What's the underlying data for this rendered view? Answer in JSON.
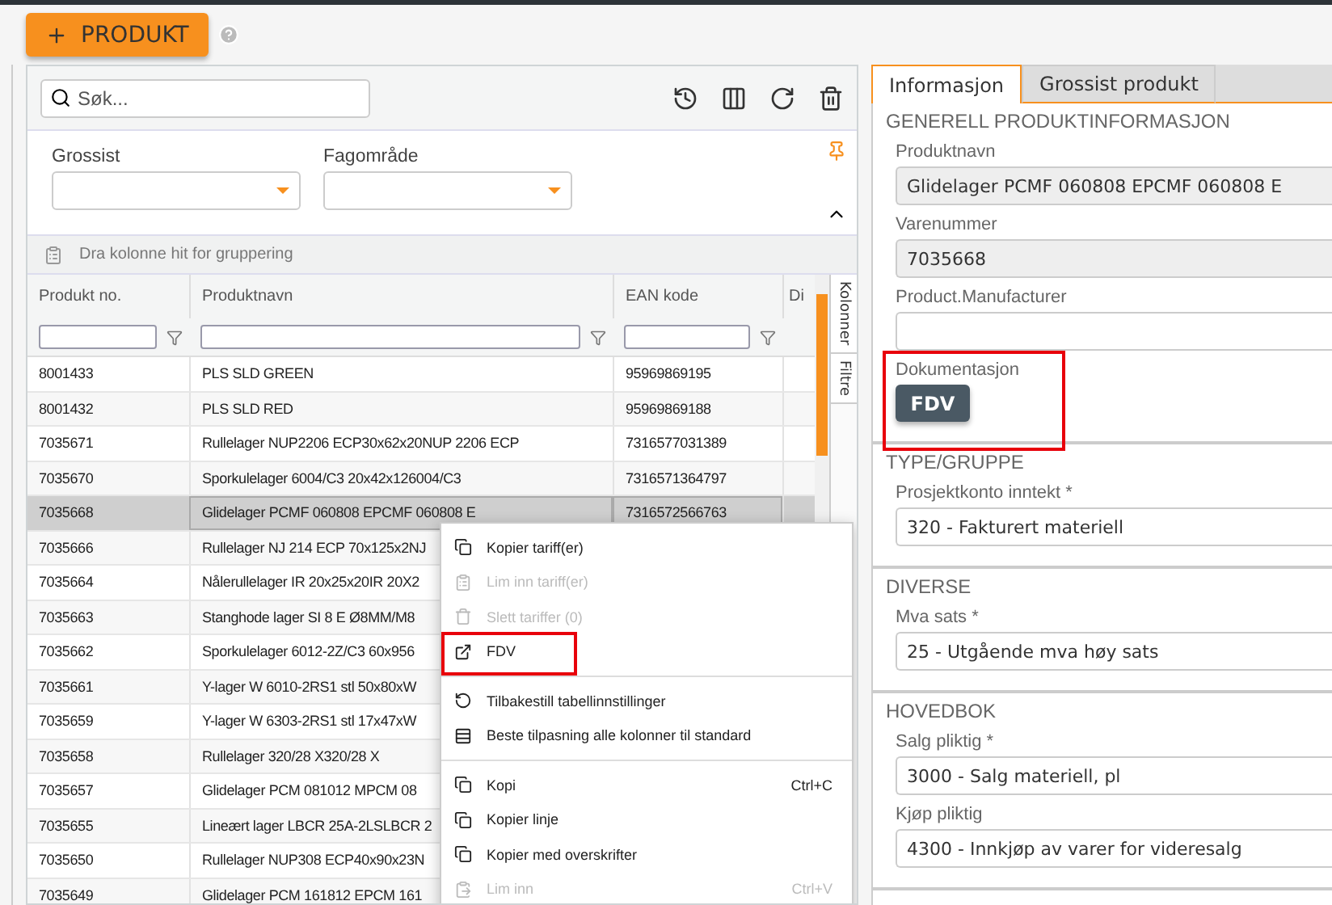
{
  "toolbar": {
    "add_button": "PRODUKT"
  },
  "grid": {
    "search": {
      "placeholder": "Søk..."
    },
    "filters": [
      {
        "label": "Grossist"
      },
      {
        "label": "Fagområde"
      }
    ],
    "group_hint": "Dra kolonne hit for gruppering",
    "columns": [
      "Produkt no.",
      "Produktnavn",
      "EAN kode",
      "Di"
    ],
    "side_tabs": [
      "Kolonner",
      "Filtre"
    ],
    "rows": [
      {
        "no": "8001433",
        "name": "PLS SLD GREEN",
        "ean": "95969869195",
        "selected": false
      },
      {
        "no": "8001432",
        "name": "PLS SLD RED",
        "ean": "95969869188",
        "selected": false
      },
      {
        "no": "7035671",
        "name": "Rullelager NUP2206 ECP30x62x20NUP 2206 ECP",
        "ean": "7316577031389",
        "selected": false
      },
      {
        "no": "7035670",
        "name": "Sporkulelager 6004/C3 20x42x126004/C3",
        "ean": "7316571364797",
        "selected": false
      },
      {
        "no": "7035668",
        "name": "Glidelager PCMF 060808 EPCMF 060808 E",
        "ean": "7316572566763",
        "selected": true
      },
      {
        "no": "7035666",
        "name": "Rullelager NJ 214 ECP 70x125x2NJ",
        "ean": "",
        "selected": false
      },
      {
        "no": "7035664",
        "name": "Nålerullelager IR 20x25x20IR 20X2",
        "ean": "",
        "selected": false
      },
      {
        "no": "7035663",
        "name": "Stanghode lager SI 8 E Ø8MM/M8",
        "ean": "",
        "selected": false
      },
      {
        "no": "7035662",
        "name": "Sporkulelager 6012-2Z/C3 60x956",
        "ean": "",
        "selected": false
      },
      {
        "no": "7035661",
        "name": "Y-lager W 6010-2RS1 stl 50x80xW",
        "ean": "",
        "selected": false
      },
      {
        "no": "7035659",
        "name": "Y-lager W 6303-2RS1 stl 17x47xW",
        "ean": "",
        "selected": false
      },
      {
        "no": "7035658",
        "name": "Rullelager 320/28 X320/28 X",
        "ean": "",
        "selected": false
      },
      {
        "no": "7035657",
        "name": "Glidelager PCM 081012 MPCM 08",
        "ean": "",
        "selected": false
      },
      {
        "no": "7035655",
        "name": "Lineært lager LBCR 25A-2LSLBCR 2",
        "ean": "",
        "selected": false
      },
      {
        "no": "7035650",
        "name": "Rullelager NUP308 ECP40x90x23N",
        "ean": "",
        "selected": false
      },
      {
        "no": "7035649",
        "name": "Glidelager PCM 161812 EPCM 161",
        "ean": "",
        "selected": false
      }
    ]
  },
  "context_menu": [
    {
      "kind": "item",
      "label": "Kopier tariff(er)",
      "disabled": false,
      "highlighted": false
    },
    {
      "kind": "item",
      "label": "Lim inn tariff(er)",
      "disabled": true,
      "highlighted": false
    },
    {
      "kind": "item",
      "label": "Slett tariffer (0)",
      "disabled": true,
      "highlighted": false
    },
    {
      "kind": "item",
      "label": "FDV",
      "disabled": false,
      "highlighted": true
    },
    {
      "kind": "divider"
    },
    {
      "kind": "item",
      "label": "Tilbakestill tabellinnstillinger",
      "disabled": false,
      "highlighted": false
    },
    {
      "kind": "item",
      "label": "Beste tilpasning alle kolonner til standard",
      "disabled": false,
      "highlighted": false
    },
    {
      "kind": "divider"
    },
    {
      "kind": "item",
      "label": "Kopi",
      "shortcut": "Ctrl+C",
      "disabled": false,
      "highlighted": false
    },
    {
      "kind": "item",
      "label": "Kopier linje",
      "disabled": false,
      "highlighted": false
    },
    {
      "kind": "item",
      "label": "Kopier med overskrifter",
      "disabled": false,
      "highlighted": false
    },
    {
      "kind": "item",
      "label": "Lim inn",
      "shortcut": "Ctrl+V",
      "disabled": true,
      "highlighted": false
    }
  ],
  "detail": {
    "tabs": [
      {
        "label": "Informasjon",
        "selected": true
      },
      {
        "label": "Grossist produkt",
        "selected": false
      }
    ],
    "sections": [
      {
        "title": "GENERELL PRODUKTINFORMASJON",
        "fields": [
          {
            "kind": "input",
            "label": "Produktnavn",
            "value": "Glidelager PCMF 060808 EPCMF 060808 E",
            "disabled": true
          },
          {
            "kind": "input",
            "label": "Varenummer",
            "value": "7035668",
            "disabled": true
          },
          {
            "kind": "input",
            "label": "Product.Manufacturer",
            "disabled": false
          },
          {
            "kind": "button",
            "label": "Dokumentasjon",
            "value": "FDV",
            "highlighted": true
          }
        ]
      },
      {
        "title": "TYPE/GRUPPE",
        "fields": [
          {
            "kind": "input",
            "label": "Prosjektkonto inntekt *",
            "value": "320 - Fakturert materiell",
            "disabled": false
          }
        ]
      },
      {
        "title": "DIVERSE",
        "fields": [
          {
            "kind": "input",
            "label": "Mva sats *",
            "value": "25 - Utgående mva høy sats",
            "disabled": false
          }
        ]
      },
      {
        "title": "HOVEDBOK",
        "fields": [
          {
            "kind": "input",
            "label": "Salg pliktig *",
            "value": "3000 - Salg materiell, pl",
            "disabled": false
          },
          {
            "kind": "input",
            "label": "Kjøp pliktig",
            "value": "4300 - Innkjøp av varer for videresalg",
            "disabled": false
          }
        ]
      }
    ]
  }
}
